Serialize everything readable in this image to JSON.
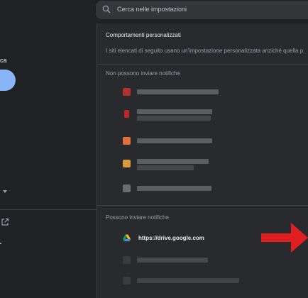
{
  "search": {
    "placeholder": "Cerca nelle impostazioni"
  },
  "sidebar": {
    "partial_label": "ca"
  },
  "content": {
    "title": "Comportamenti personalizzati",
    "description": "I siti elencati di seguito usano un'impostazione personalizzata anziché quella p",
    "blocked_section": {
      "heading": "Non possono inviare notifiche",
      "sites": [
        {
          "favicon_color": "#b3312a"
        },
        {
          "favicon_color": "#c0262d"
        },
        {
          "favicon_color": "#e0703a"
        },
        {
          "favicon_color": "#d79a3a"
        },
        {
          "favicon_color": "#6b6c70"
        }
      ]
    },
    "allowed_section": {
      "heading": "Possono inviare notifiche",
      "sites": [
        {
          "name": "https://drive.google.com",
          "icon": "google-drive-icon"
        },
        {
          "favicon_color": "#3a3b3f"
        },
        {
          "favicon_color": "#3a3b3f"
        }
      ]
    }
  },
  "colors": {
    "accent": "#8ab4f8",
    "arrow": "#e02020"
  }
}
